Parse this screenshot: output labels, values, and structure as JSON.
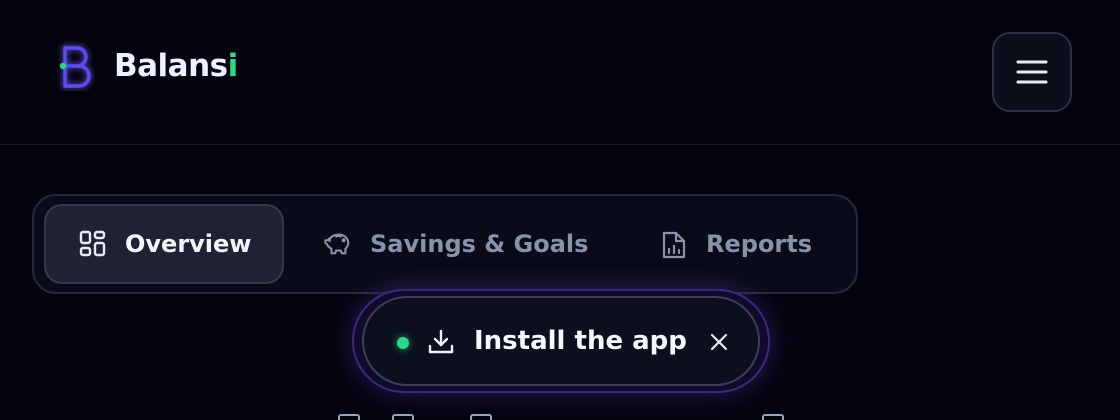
{
  "brand": {
    "name_main": "Balans",
    "name_accent": "i",
    "logo_icon": "b-logo-icon",
    "logo_color": "#5b4ee6",
    "logo_dot_color": "#2dd88a"
  },
  "header": {
    "menu_icon": "hamburger-menu-icon"
  },
  "tabs": [
    {
      "label": "Overview",
      "icon": "grid-icon",
      "active": true
    },
    {
      "label": "Savings & Goals",
      "icon": "piggy-bank-icon",
      "active": false
    },
    {
      "label": "Reports",
      "icon": "report-document-icon",
      "active": false
    }
  ],
  "install_banner": {
    "label": "Install the app",
    "status_dot_color": "#2dd88a",
    "download_icon": "download-icon",
    "close_icon": "close-icon"
  },
  "colors": {
    "background": "#04040f",
    "accent_green": "#2dd88a",
    "accent_purple": "#5b4ee6",
    "muted_text": "#8893ab"
  }
}
